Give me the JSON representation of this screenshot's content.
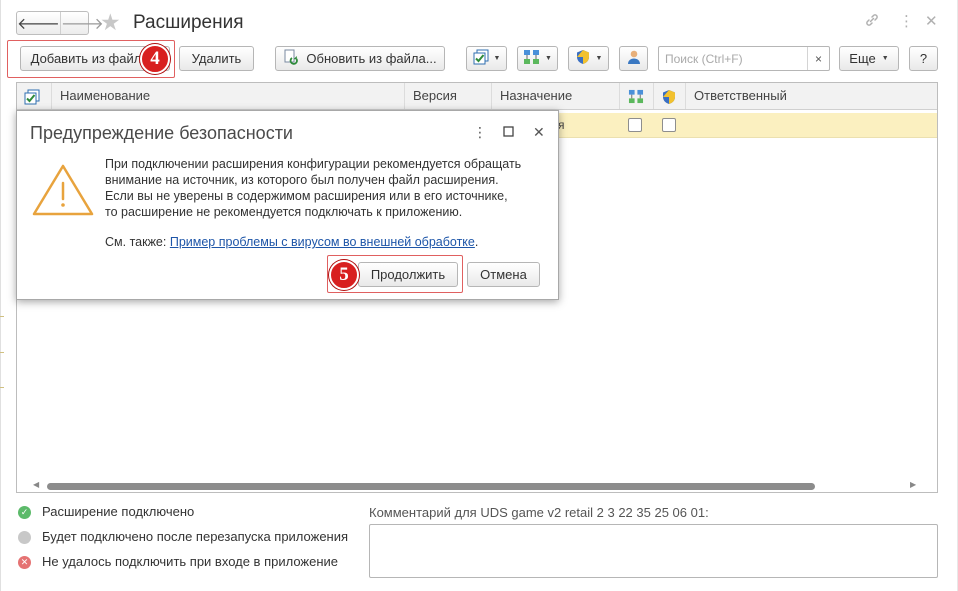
{
  "window": {
    "title": "Расширения",
    "nav": {
      "back_icon": "arrow-left-icon",
      "forward_icon": "arrow-right-icon"
    },
    "favorite_icon": "star-icon",
    "header_icons": [
      "link-icon",
      "more-vertical-icon",
      "close-icon"
    ]
  },
  "toolbar": {
    "add_from_file": "Добавить из файла...",
    "delete": "Удалить",
    "update_from_file": "Обновить из файла...",
    "search_placeholder": "Поиск (Ctrl+F)",
    "search_clear": "×",
    "more": "Еще",
    "help": "?"
  },
  "grid": {
    "columns": [
      "Наименование",
      "Версия",
      "Назначение",
      "Ответственный"
    ],
    "selected_row": {
      "purpose_fragment": "я"
    }
  },
  "legend": [
    {
      "text": "Расширение подключено",
      "color": "#5cba6a"
    },
    {
      "text": "Будет подключено после перезапуска приложения",
      "color": "#c8c8c8"
    },
    {
      "text": "Не удалось подключить при входе в приложение",
      "color": "#e57373"
    }
  ],
  "comment": {
    "label": "Комментарий для UDS game v2 retail 2 3 22 35 25 06 01:"
  },
  "dialog": {
    "title": "Предупреждение безопасности",
    "body": [
      "При подключении расширения конфигурации рекомендуется обращать",
      "внимание на источник, из которого был получен файл расширения.",
      "Если вы не уверены в содержимом расширения или в его источнике,",
      "то расширение не рекомендуется подключать к приложению."
    ],
    "see_also_prefix": "См. также: ",
    "see_also_link": "Пример проблемы с вирусом во внешней обработке",
    "see_also_suffix": ".",
    "continue": "Продолжить",
    "cancel": "Отмена"
  },
  "markers": {
    "step4": "4",
    "step5": "5"
  },
  "colors": {
    "accent_red": "#d81f1f",
    "selection": "#fbf0c0",
    "link": "#1d55a8",
    "warning": "#e8a33d"
  }
}
